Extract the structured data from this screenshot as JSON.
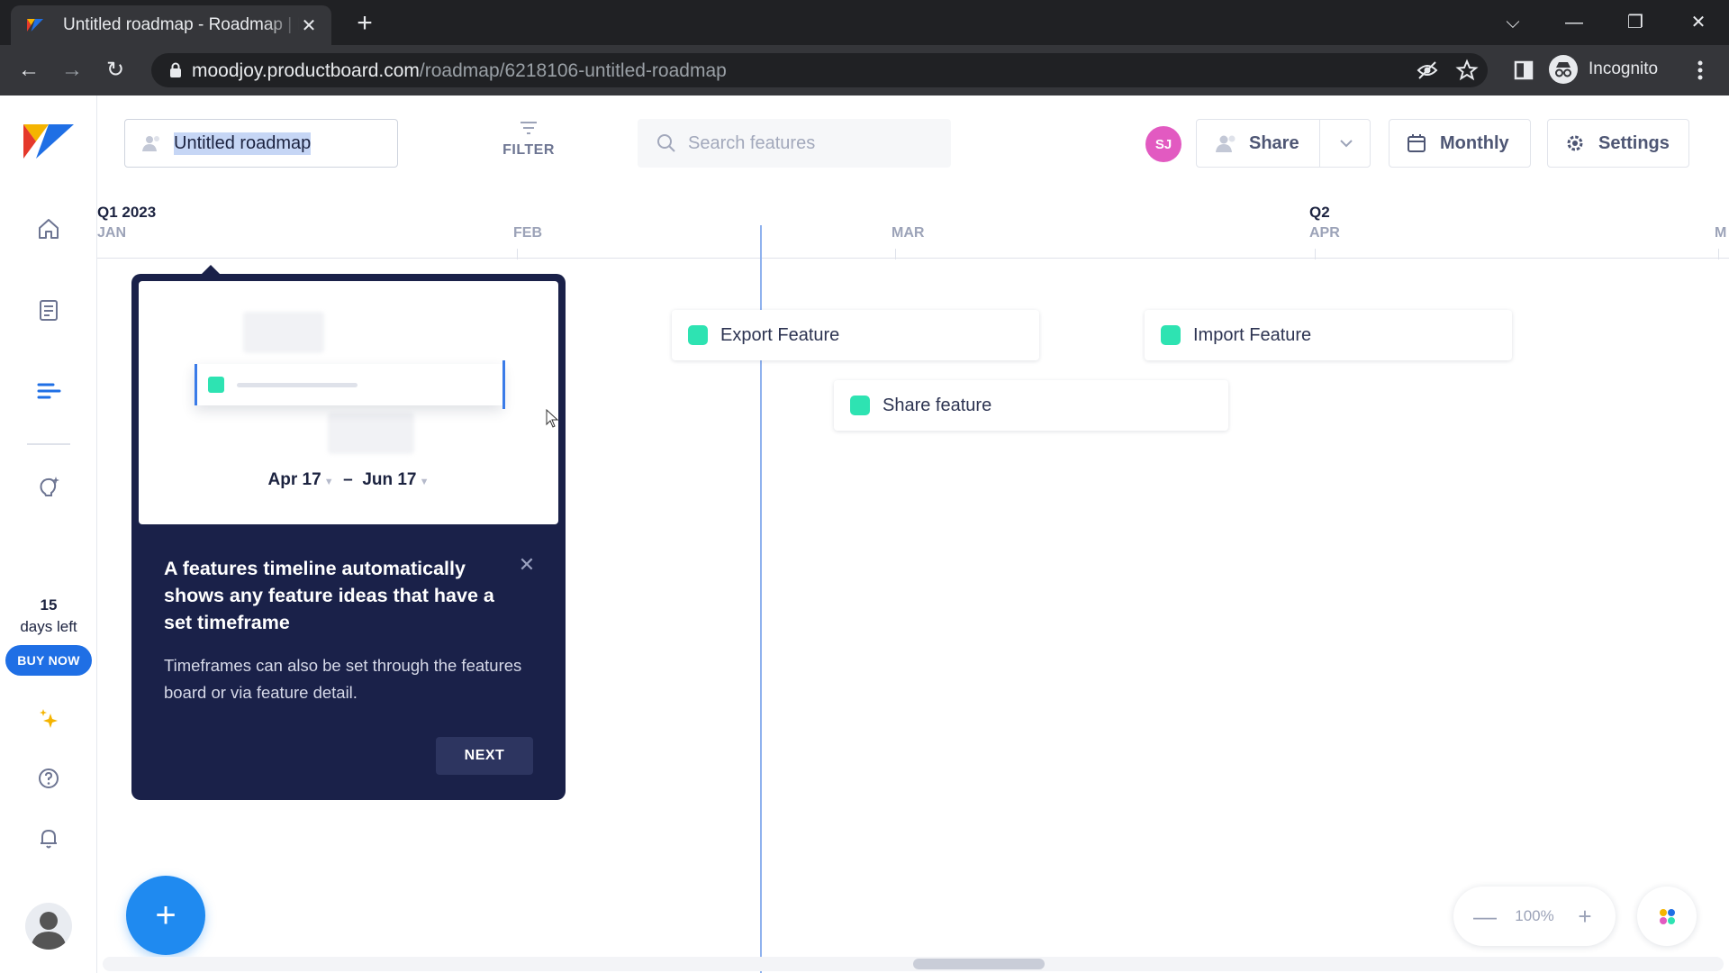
{
  "browser": {
    "tab_title": "Untitled roadmap - Roadmap | Productboard",
    "tab_close": "✕",
    "new_tab": "+",
    "window_controls": [
      "⌵",
      "—",
      "❐",
      "✕"
    ],
    "url_host": "moodjoy.productboard.com",
    "url_path": "/roadmap/6218106-untitled-roadmap",
    "profile_label": "Incognito",
    "nav": {
      "back": "←",
      "forward": "→",
      "reload": "↻"
    },
    "icons": [
      "lock-icon",
      "eye-off-icon",
      "star-icon",
      "side-panel-icon",
      "incognito-icon",
      "more-vert-icon"
    ]
  },
  "sidebar": {
    "trial_days": "15",
    "trial_label": "days left",
    "buy_label": "BUY NOW",
    "items": [
      "home-icon",
      "notes-icon",
      "roadmap-icon",
      "insights-icon",
      "whats-new-icon",
      "help-icon",
      "notifications-icon",
      "user-avatar"
    ]
  },
  "header": {
    "roadmap_title": "Untitled roadmap",
    "filter_label": "FILTER",
    "search_placeholder": "Search features",
    "user_initials": "SJ",
    "share_label": "Share",
    "monthly_label": "Monthly",
    "settings_label": "Settings"
  },
  "timeline": {
    "quarters": [
      "Q1 2023",
      "Q2"
    ],
    "months": [
      "JAN",
      "FEB",
      "MAR",
      "APR",
      "M"
    ]
  },
  "features": [
    {
      "name": "Export Feature",
      "color": "#2ee3b2"
    },
    {
      "name": "Import Feature",
      "color": "#2ee3b2"
    },
    {
      "name": "Share feature",
      "color": "#2ee3b2"
    }
  ],
  "tooltip": {
    "start_date": "Apr 17",
    "end_date": "Jun 17",
    "dash": "–",
    "title": "A features timeline automatically shows any feature ideas that have a set timeframe",
    "body": "Timeframes can also be set through the features board or via feature detail.",
    "next_label": "NEXT",
    "close": "✕"
  },
  "zoom": {
    "value": "100%",
    "minus": "—",
    "plus": "+"
  },
  "fab_label": "+",
  "colors": {
    "accent": "#1f6fe5",
    "tooltip_bg": "#1a2149",
    "feature_dot": "#2ee3b2",
    "avatar": "#e25ac1"
  }
}
